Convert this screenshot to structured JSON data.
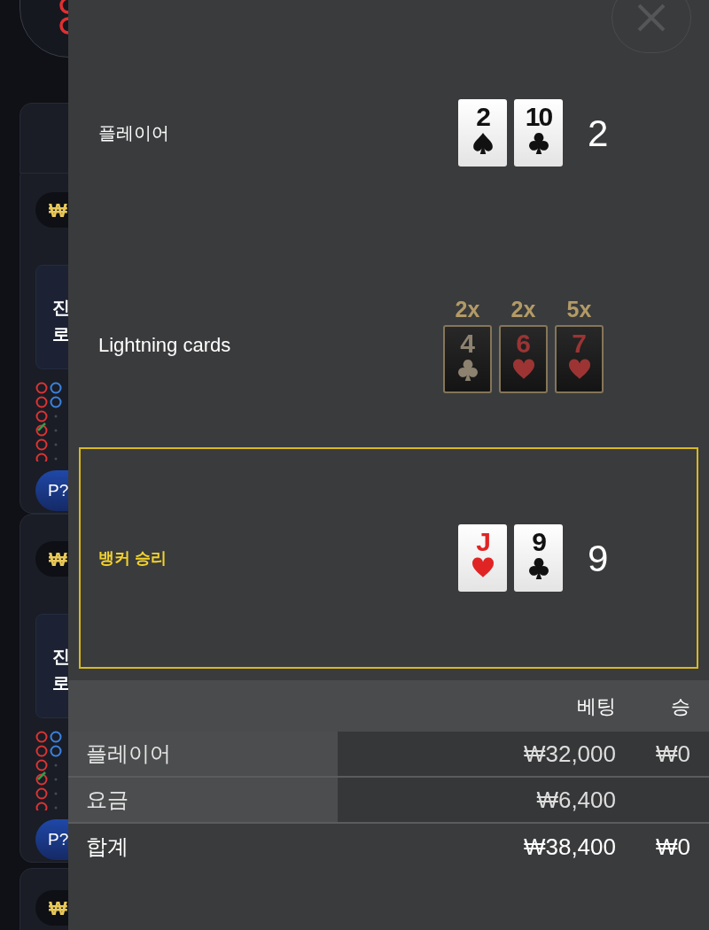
{
  "background_cards": [
    {
      "kind": "top"
    },
    {
      "kind": "table",
      "price_symbol": "₩",
      "lines": [
        "진",
        "로"
      ],
      "predict_label": "P?"
    },
    {
      "kind": "table",
      "price_symbol": "₩",
      "lines": [
        "진",
        "로"
      ],
      "predict_label": "P?"
    },
    {
      "kind": "partial",
      "price_symbol": "₩"
    }
  ],
  "result": {
    "hands": [
      {
        "kind": "hand",
        "label": "플레이어",
        "winner": false,
        "score": "2",
        "cards": [
          {
            "rank": "2",
            "kind": "spade"
          },
          {
            "rank": "10",
            "kind": "club"
          }
        ]
      },
      {
        "kind": "lightning",
        "label": "Lightning cards",
        "cards": [
          {
            "rank": "4",
            "kind": "club",
            "multiplier": "2x"
          },
          {
            "rank": "6",
            "kind": "heart",
            "multiplier": "2x"
          },
          {
            "rank": "7",
            "kind": "heart",
            "multiplier": "5x"
          }
        ]
      },
      {
        "kind": "hand",
        "label": "뱅커 승리",
        "winner": true,
        "score": "9",
        "cards": [
          {
            "rank": "J",
            "kind": "heart"
          },
          {
            "rank": "9",
            "kind": "club"
          }
        ]
      }
    ]
  },
  "bets_table": {
    "columns": [
      "베팅",
      "승"
    ],
    "rows": [
      {
        "kind": "bet",
        "label": "플레이어",
        "bet": "₩32,000",
        "win": "₩0"
      },
      {
        "kind": "bet",
        "label": "요금",
        "bet": "₩6,400"
      },
      {
        "kind": "total",
        "label": "합계",
        "bet": "₩38,400",
        "win": "₩0"
      }
    ]
  }
}
